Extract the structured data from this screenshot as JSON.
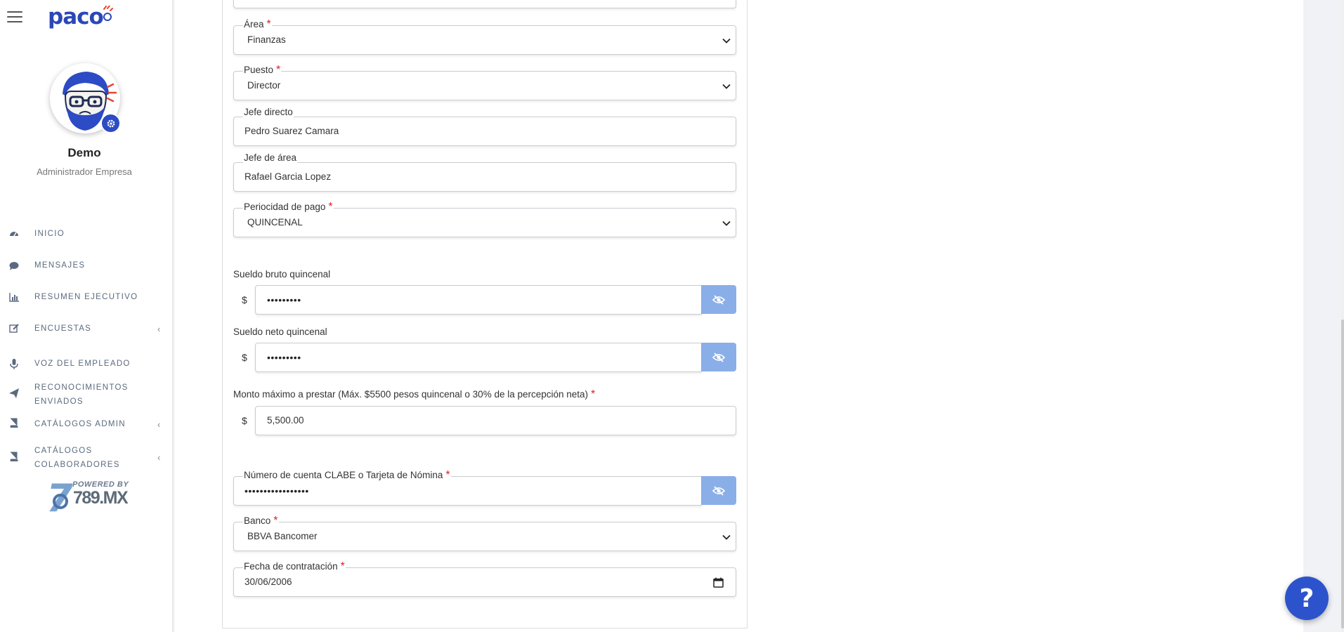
{
  "sidebar": {
    "logo_text": "paco",
    "user_name": "Demo",
    "user_role": "Administrador Empresa",
    "items": [
      {
        "label": "INICIO",
        "icon": "dashboard-icon",
        "has_caret": false
      },
      {
        "label": "MENSAJES",
        "icon": "chat-bubble-icon",
        "has_caret": false
      },
      {
        "label": "RESUMEN EJECUTIVO",
        "icon": "bar-chart-icon",
        "has_caret": false
      },
      {
        "label": "ENCUESTAS",
        "icon": "edit-icon",
        "has_caret": true
      },
      {
        "label": "VOZ DEL EMPLEADO",
        "icon": "microphone-icon",
        "has_caret": false
      },
      {
        "label": "RECONOCIMIENTOS",
        "label2": "ENVIADOS",
        "icon": "paper-plane-icon",
        "has_caret": false
      },
      {
        "label": "CATÁLOGOS ADMIN",
        "icon": "book-icon",
        "has_caret": true
      },
      {
        "label": "CATÁLOGOS",
        "label2": "COLABORADORES",
        "icon": "book-icon",
        "has_caret": true
      }
    ],
    "caret": "‹",
    "powered_by": "POWERED BY",
    "powered_brand": "789.MX"
  },
  "form": {
    "area": {
      "label": "Área",
      "value": "Finanzas",
      "required": "*"
    },
    "puesto": {
      "label": "Puesto",
      "value": "Director",
      "required": "*"
    },
    "jefe_directo": {
      "label": "Jefe directo",
      "value": "Pedro Suarez Camara"
    },
    "jefe_area": {
      "label": "Jefe de área",
      "value": "Rafael Garcia Lopez"
    },
    "periodicidad": {
      "label": "Periocidad de pago",
      "value": "QUINCENAL",
      "required": "*"
    },
    "sueldo_bruto": {
      "label": "Sueldo bruto quincenal",
      "currency": "$",
      "value": "•••••••••"
    },
    "sueldo_neto": {
      "label": "Sueldo neto quincenal",
      "currency": "$",
      "value": "•••••••••"
    },
    "monto_maximo": {
      "label": "Monto máximo a prestar (Máx. $5500 pesos quincenal o 30% de la percepción neta)",
      "currency": "$",
      "value": "5,500.00",
      "required": "*"
    },
    "clabe": {
      "label": "Número de cuenta CLABE o Tarjeta de Nómina",
      "value": "•••••••••••••••••",
      "required": "*"
    },
    "banco": {
      "label": "Banco",
      "value": "BBVA Bancomer",
      "required": "*"
    },
    "fecha": {
      "label": "Fecha de contratación",
      "value": "30/06/2006",
      "required": "*"
    }
  },
  "help_button": "?",
  "colors": {
    "brand": "#2b48b8",
    "eye_button": "#8aaee8",
    "required": "#e02020",
    "help": "#2d53cc"
  }
}
